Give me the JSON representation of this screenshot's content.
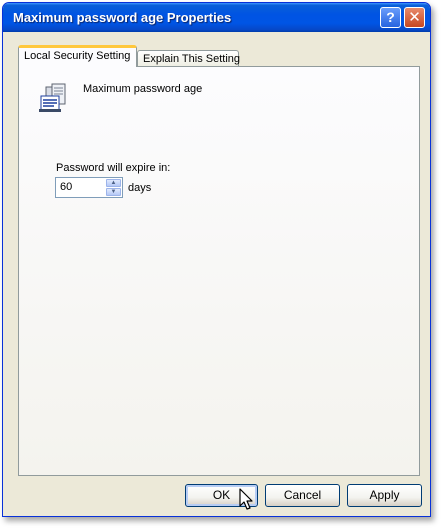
{
  "window": {
    "title": "Maximum password age Properties",
    "help_glyph": "?",
    "close_glyph": "✕"
  },
  "tabs": [
    {
      "label": "Local Security Setting",
      "active": true
    },
    {
      "label": "Explain This Setting",
      "active": false
    }
  ],
  "setting": {
    "icon": "policy-document-icon",
    "name": "Maximum password age"
  },
  "expire": {
    "label": "Password will expire in:",
    "value": "60",
    "unit": "days",
    "up_glyph": "▲",
    "down_glyph": "▼"
  },
  "buttons": {
    "ok": "OK",
    "cancel": "Cancel",
    "apply": "Apply"
  },
  "colors": {
    "titlebar": "#0054e3",
    "dialog_bg": "#ece9d8",
    "active_tab_accent": "#ffc83c"
  }
}
